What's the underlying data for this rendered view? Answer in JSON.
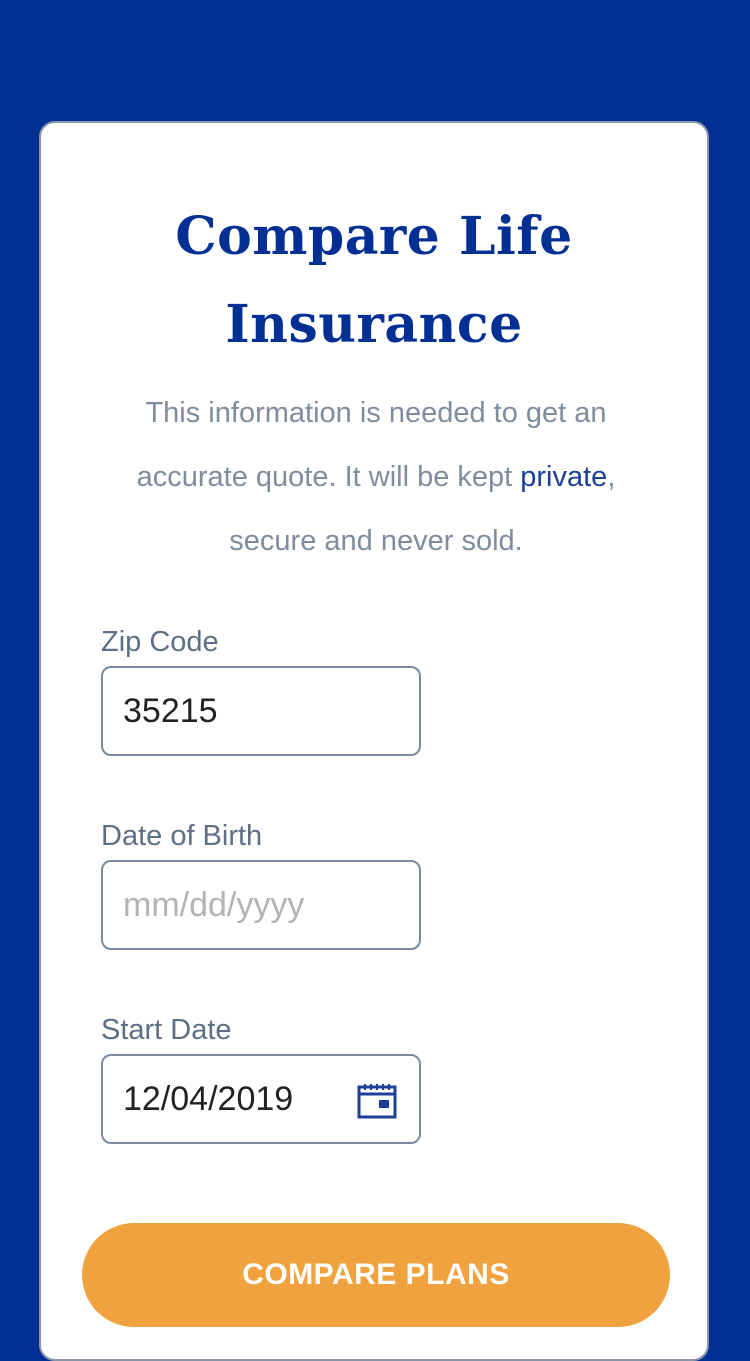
{
  "form": {
    "title_line1": "Compare Life",
    "title_line2": "Insurance",
    "subtitle_before": "This information is needed to get an accurate quote. It will be kept ",
    "subtitle_link": "private",
    "subtitle_after": ", secure and never sold.",
    "zip": {
      "label": "Zip Code",
      "value": "35215"
    },
    "dob": {
      "label": "Date of Birth",
      "value": "",
      "placeholder": "mm/dd/yyyy"
    },
    "start": {
      "label": "Start Date",
      "value": "12/04/2019",
      "icon": "calendar-icon"
    },
    "submit_label": "COMPARE PLANS"
  },
  "colors": {
    "brand_blue": "#022f94",
    "accent_orange": "#efa23e",
    "muted_text": "#7f8c9d",
    "label_text": "#5e6f85"
  }
}
